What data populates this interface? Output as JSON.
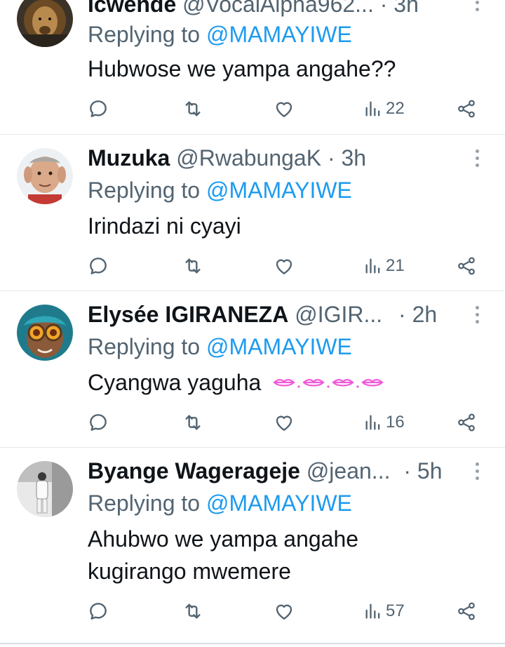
{
  "replies": [
    {
      "name": "Icwende",
      "handle": "@VocalAlpha962...",
      "time": "· 3h",
      "reply_prefix": "Replying to",
      "reply_to": "@MAMAYIWE",
      "text": "Hubwose we yampa angahe??",
      "views": "22",
      "avatar_icon": "lion-avatar-icon"
    },
    {
      "name": "Muzuka",
      "handle": "@RwabungaK",
      "time": "· 3h",
      "reply_prefix": "Replying to",
      "reply_to": "@MAMAYIWE",
      "text": "Irindazi ni cyayi",
      "views": "21",
      "avatar_icon": "old-man-avatar-icon"
    },
    {
      "name": "Elysée IGIRANEZA",
      "handle": "@IGIR...",
      "time": "· 2h",
      "reply_prefix": "Replying to",
      "reply_to": "@MAMAYIWE",
      "text": "Cyangwa yaguha",
      "emoji_name": "kissing-lips-emoji",
      "views": "16",
      "avatar_icon": "monkey-goggles-avatar-icon"
    },
    {
      "name": "Byange Wagerageje",
      "handle": "@jean...",
      "time": "· 5h",
      "reply_prefix": "Replying to",
      "reply_to": "@MAMAYIWE",
      "text_line1": "Ahubwo we yampa angahe",
      "text_line2": "kugirango mwemere",
      "views": "57",
      "avatar_icon": "person-photo-avatar-icon"
    }
  ],
  "colors": {
    "mention": "#1d9bf0",
    "secondary_text": "#536471",
    "primary_text": "#0f1419",
    "emoji_pink": "#f05ad8"
  }
}
